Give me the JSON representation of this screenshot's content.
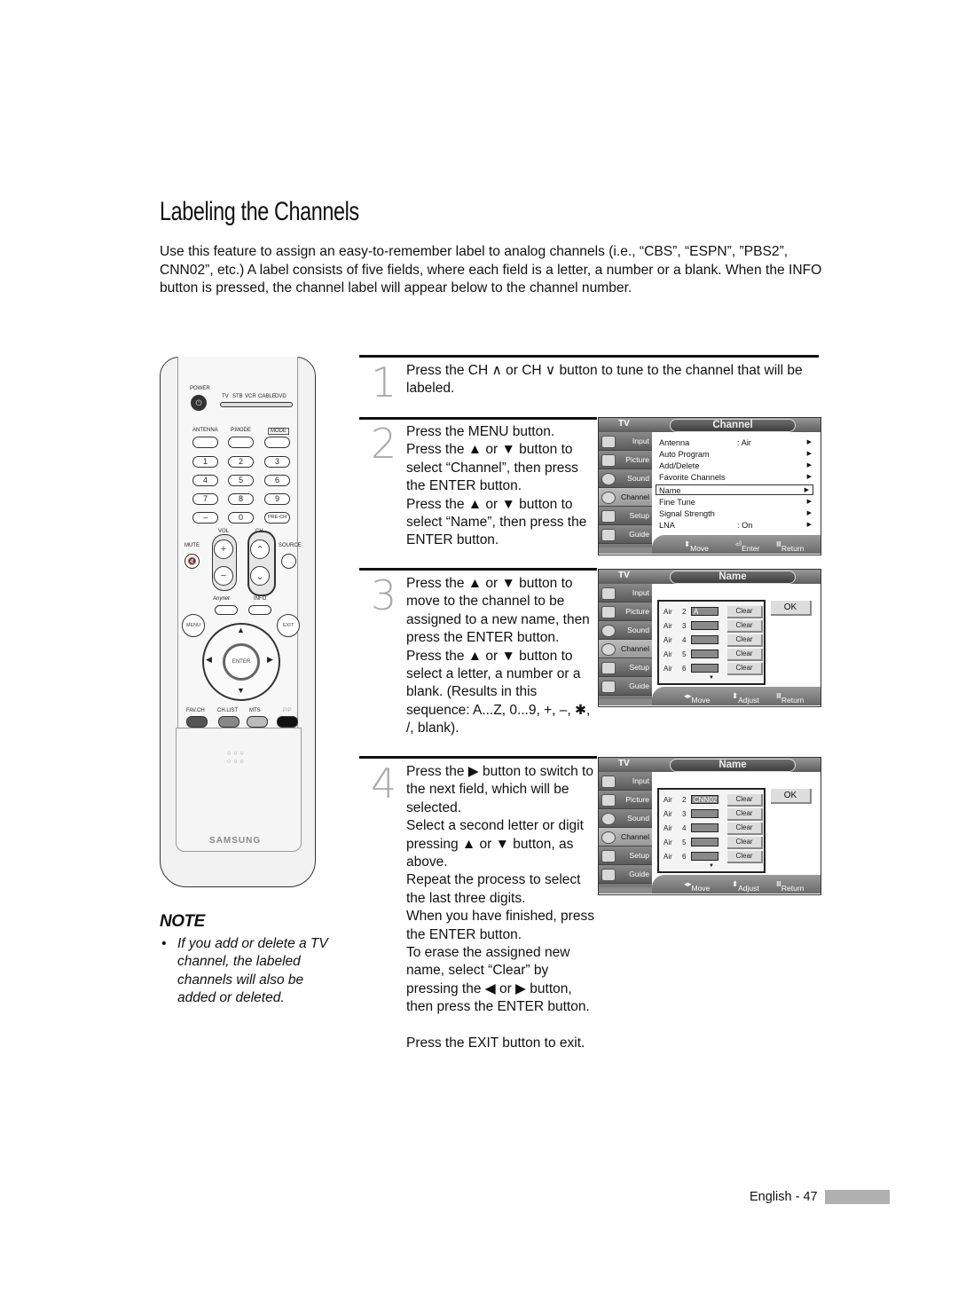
{
  "page": {
    "title": "Labeling the Channels",
    "intro": "Use this feature to assign an easy-to-remember label to analog channels (i.e., “CBS”, “ESPN”, ”PBS2”, CNN02”, etc.) A label consists of five fields, where each field is a letter, a number or a blank. When the INFO button is pressed, the channel label will appear below to the channel number.",
    "footer": {
      "language": "English",
      "separator": "-",
      "page_number": "47",
      "label": "English - 47"
    }
  },
  "remote": {
    "labels": {
      "power": "POWER",
      "modes": [
        "TV",
        "STB",
        "VCR",
        "CABLE",
        "DVD"
      ],
      "antenna": "ANTENNA",
      "pmode": "P.MODE",
      "mode": "MODE",
      "vol": "VOL",
      "ch": "CH",
      "mute": "MUTE",
      "source": "SOURCE",
      "anynet": "Anynet",
      "info": "INFO",
      "menu": "MENU",
      "exit": "EXIT",
      "enter": "ENTER",
      "favch": "FAV.CH",
      "chlist": "CH.LIST",
      "mts": "MTS",
      "pip": "PIP",
      "brand": "SAMSUNG"
    },
    "number_keys": [
      "1",
      "2",
      "3",
      "4",
      "5",
      "6",
      "7",
      "8",
      "9",
      "–",
      "0",
      "PRE-CH"
    ]
  },
  "note": {
    "heading": "NOTE",
    "bullet": "•",
    "text": "If you add or delete a TV channel, the labeled channels will also be added or deleted."
  },
  "steps": [
    {
      "number": "1",
      "lines": [
        "Press the CH ∧ or CH ∨ button to tune to the channel that will be labeled."
      ]
    },
    {
      "number": "2",
      "lines": [
        "Press the MENU button.",
        "Press the ▲ or ▼ button to select “Channel”, then press the ENTER button.",
        "Press the ▲ or ▼ button to select “Name”, then press the ENTER button."
      ]
    },
    {
      "number": "3",
      "lines": [
        "Press the ▲ or ▼ button to move to the channel to be assigned to a new name, then press the ENTER button.",
        "Press the ▲ or ▼ button to select a letter, a number or a blank. (Results in this sequence: A...Z, 0...9, +, –, ✱, /, blank)."
      ]
    },
    {
      "number": "4",
      "lines": [
        "Press the ▶ button to switch to the next field, which will be selected.",
        "Select a second letter or digit pressing ▲ or ▼ button, as above.",
        "Repeat the process to select the last three digits.",
        "When you have finished, press the ENTER button.",
        "To erase the assigned new name, select “Clear” by pressing the ◀ or ▶ button, then press the ENTER button.",
        "",
        "Press the EXIT button to exit."
      ]
    }
  ],
  "osd": {
    "tv_label": "TV",
    "sidebar": [
      "Input",
      "Picture",
      "Sound",
      "Channel",
      "Setup",
      "Guide"
    ],
    "active_sidebar": "Channel",
    "channel_menu": {
      "title": "Channel",
      "items": [
        {
          "label": "Antenna",
          "value": ": Air"
        },
        {
          "label": "Auto Program",
          "value": ""
        },
        {
          "label": "Add/Delete",
          "value": ""
        },
        {
          "label": "Favorite Channels",
          "value": ""
        },
        {
          "label": "Name",
          "value": "",
          "selected": true
        },
        {
          "label": "Fine Tune",
          "value": ""
        },
        {
          "label": "Signal Strength",
          "value": ""
        },
        {
          "label": "LNA",
          "value": ": On"
        }
      ],
      "footer": {
        "move": "Move",
        "enter": "Enter",
        "return": "Return"
      }
    },
    "name_screen_1": {
      "title": "Name",
      "ok": "OK",
      "rows": [
        {
          "antenna": "Air",
          "channel": "2",
          "label": "A",
          "clear": "Clear"
        },
        {
          "antenna": "Air",
          "channel": "3",
          "label": "",
          "clear": "Clear"
        },
        {
          "antenna": "Air",
          "channel": "4",
          "label": "",
          "clear": "Clear"
        },
        {
          "antenna": "Air",
          "channel": "5",
          "label": "",
          "clear": "Clear"
        },
        {
          "antenna": "Air",
          "channel": "6",
          "label": "",
          "clear": "Clear"
        }
      ],
      "footer": {
        "move": "Move",
        "adjust": "Adjust",
        "return": "Return"
      }
    },
    "name_screen_2": {
      "title": "Name",
      "ok": "OK",
      "rows": [
        {
          "antenna": "Air",
          "channel": "2",
          "label": "CNN02",
          "clear": "Clear"
        },
        {
          "antenna": "Air",
          "channel": "3",
          "label": "",
          "clear": "Clear"
        },
        {
          "antenna": "Air",
          "channel": "4",
          "label": "",
          "clear": "Clear"
        },
        {
          "antenna": "Air",
          "channel": "5",
          "label": "",
          "clear": "Clear"
        },
        {
          "antenna": "Air",
          "channel": "6",
          "label": "",
          "clear": "Clear"
        }
      ],
      "footer": {
        "move": "Move",
        "adjust": "Adjust",
        "return": "Return"
      }
    }
  }
}
